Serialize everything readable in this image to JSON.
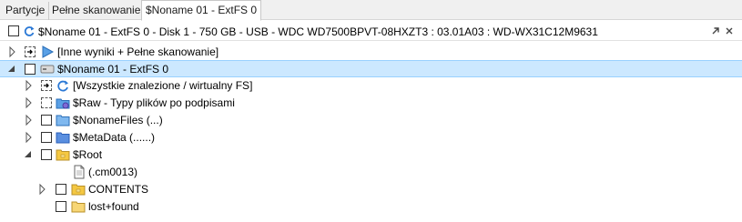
{
  "tabs": [
    {
      "label": "Partycje"
    },
    {
      "label": "Pełne skanowanie"
    },
    {
      "label": "$Noname 01 - ExtFS 0"
    }
  ],
  "header": {
    "title": "$Noname 01 - ExtFS 0 - Disk 1 - 750 GB - USB - WDC WD7500BPVT-08HXZT3 : 03.01A03 : WD-WX31C12M9631"
  },
  "tree": [
    {
      "label": "[Inne wyniki + Pełne skanowanie]",
      "icon": "play-icon"
    },
    {
      "label": "$Noname 01 - ExtFS 0",
      "icon": "drive-icon"
    },
    {
      "label": "[Wszystkie znalezione / wirtualny FS]",
      "icon": "refresh-icon"
    },
    {
      "label": "$Raw - Typy plików po podpisami",
      "icon": "raw-folder-icon"
    },
    {
      "label": "$NonameFiles (...)",
      "icon": "folder-blue-icon"
    },
    {
      "label": "$MetaData (......)",
      "icon": "folder-blue-icon"
    },
    {
      "label": "$Root",
      "icon": "folder-yellow-icon"
    },
    {
      "label": "(.cm0013)",
      "icon": "file-icon"
    },
    {
      "label": "CONTENTS",
      "icon": "folder-yellow-icon"
    },
    {
      "label": "lost+found",
      "icon": "folder-yellow-icon"
    }
  ],
  "colors": {
    "selection": "#cce8ff",
    "folder_blue": "#5aa0e6",
    "folder_yellow": "#f5c842",
    "accent": "#2b79d6"
  }
}
